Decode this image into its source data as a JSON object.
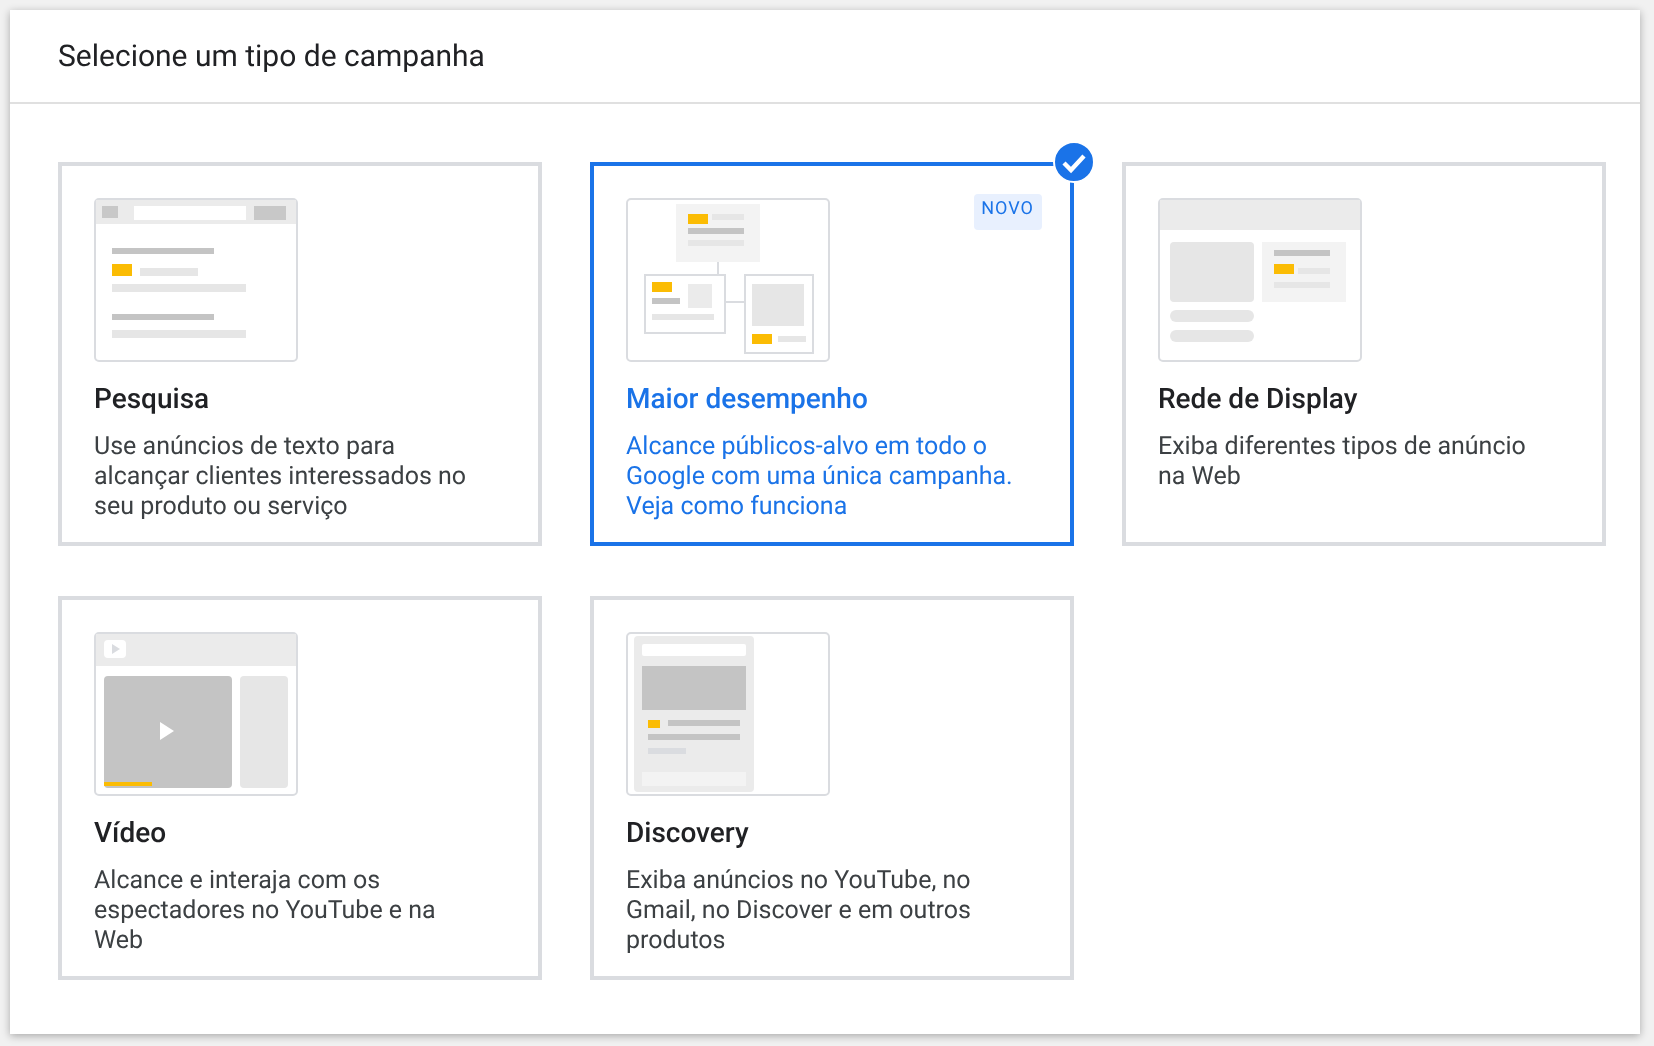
{
  "dialog": {
    "title": "Selecione um tipo de campanha"
  },
  "cards": [
    {
      "kind": "search",
      "title": "Pesquisa",
      "description": "Use anúncios de texto para alcançar clientes interessados no seu produto ou serviço",
      "selected": false
    },
    {
      "kind": "performance",
      "title": "Maior desempenho",
      "description": "Alcance públicos-alvo em todo o Google com uma única campanha. Veja como funciona",
      "selected": true,
      "badge": "NOVO"
    },
    {
      "kind": "display",
      "title": "Rede de Display",
      "description": "Exiba diferentes tipos de anúncio na Web",
      "selected": false
    },
    {
      "kind": "video",
      "title": "Vídeo",
      "description": "Alcance e interaja com os espectadores no YouTube e na Web",
      "selected": false
    },
    {
      "kind": "discovery",
      "title": "Discovery",
      "description": "Exiba anúncios no YouTube, no Gmail, no Discover e em outros produtos",
      "selected": false
    }
  ]
}
